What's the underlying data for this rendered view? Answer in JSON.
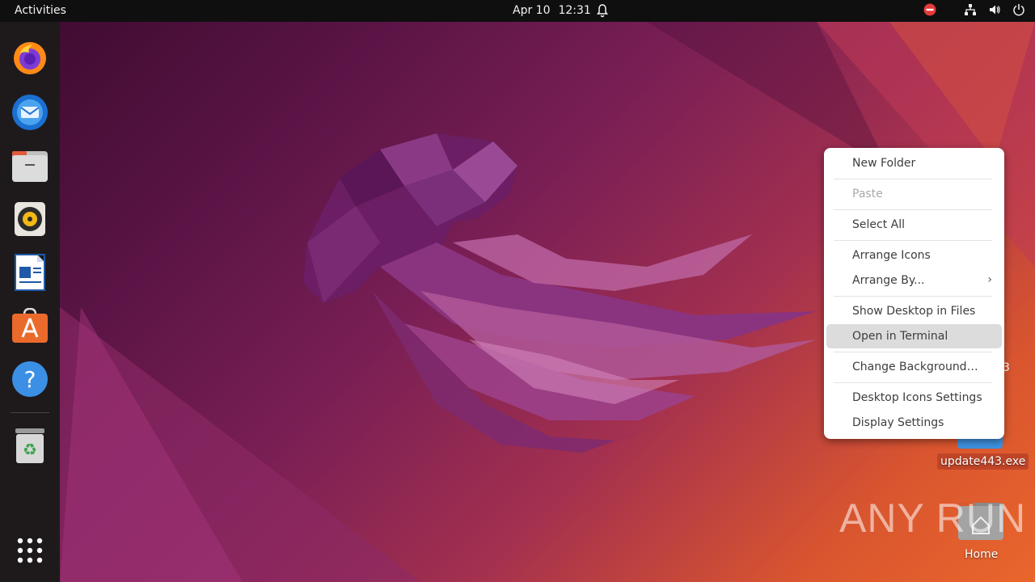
{
  "topbar": {
    "activities": "Activities",
    "date": "Apr 10",
    "time": "12:31"
  },
  "dock": {
    "items": [
      {
        "name": "Firefox",
        "icon": "firefox-icon"
      },
      {
        "name": "Thunderbird",
        "icon": "thunderbird-icon"
      },
      {
        "name": "Files",
        "icon": "files-icon"
      },
      {
        "name": "Rhythmbox",
        "icon": "rhythmbox-icon"
      },
      {
        "name": "LibreOffice Writer",
        "icon": "writer-icon"
      },
      {
        "name": "Ubuntu Software",
        "icon": "software-icon"
      },
      {
        "name": "Help",
        "icon": "help-icon"
      },
      {
        "name": "Trash",
        "icon": "trash-icon"
      },
      {
        "name": "Show Applications",
        "icon": "app-grid-icon"
      }
    ]
  },
  "context_menu": {
    "items": [
      {
        "label": "New Folder",
        "enabled": true
      },
      {
        "label": "Paste",
        "enabled": false
      },
      {
        "label": "Select All",
        "enabled": true
      },
      {
        "label": "Arrange Icons",
        "enabled": true
      },
      {
        "label": "Arrange By...",
        "enabled": true,
        "submenu": true
      },
      {
        "label": "Show Desktop in Files",
        "enabled": true
      },
      {
        "label": "Open in Terminal",
        "enabled": true,
        "highlighted": true
      },
      {
        "label": "Change Background…",
        "enabled": true
      },
      {
        "label": "Desktop Icons Settings",
        "enabled": true
      },
      {
        "label": "Display Settings",
        "enabled": true
      }
    ],
    "submenu_arrow": "›"
  },
  "desktop_icons": {
    "exe_label": "update443.exe",
    "home_label": "Home",
    "partial_label": "3"
  },
  "watermark": "ANY RUN",
  "colors": {
    "topbar": "#0f0f0f",
    "dock": "#1e1a1c",
    "menu_highlight": "#dcdcdc",
    "exe_label_bg": "#c04528"
  }
}
